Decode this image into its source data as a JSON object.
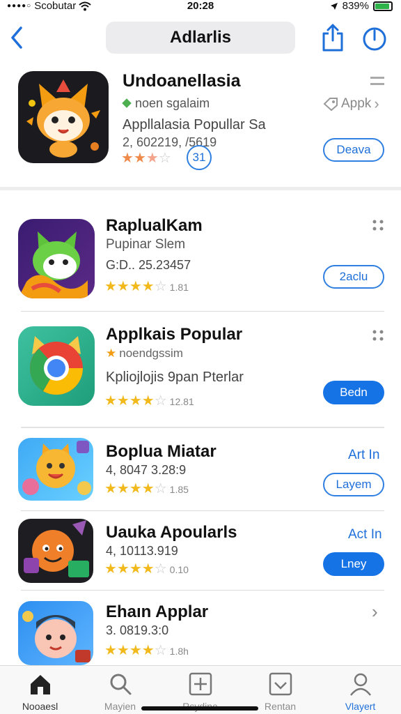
{
  "status_bar": {
    "carrier": "Scobutar",
    "time": "20:28",
    "battery_text": "839%"
  },
  "nav": {
    "title": "Adlarlis"
  },
  "featured": {
    "name": "Undoanellasia",
    "category": "noen sgalaim",
    "description": "Appllalasia Popullar Sa",
    "meta": "2, 602219, /5619",
    "rating": 3,
    "rating_count_badge": "31",
    "side_link": "Appk",
    "button_label": "Deava",
    "accent": "#1e6fd9"
  },
  "apps": [
    {
      "name": "RaplualKam",
      "subtitle": "Pupinar Slem",
      "meta": "G:D.. 25.23457",
      "rating": 4,
      "count": "1.81",
      "button_label": "2aclu",
      "button_style": "outline",
      "show_more": true
    },
    {
      "name": "Applkais Popular",
      "subtitle": "noendgssim",
      "meta": "Kpliojlojis 9pan Pterlar",
      "rating": 4,
      "count": "12.81",
      "button_label": "Bedn",
      "button_style": "fill",
      "show_more": true
    },
    {
      "name": "Boplua Miatar",
      "subtitle": "",
      "meta": "4, 8047 3.28:9",
      "rating": 4,
      "count": "1.85",
      "link_label": "Art In",
      "button_label": "Layem",
      "button_style": "outline",
      "show_more": false
    },
    {
      "name": "Uauka Apoularls",
      "subtitle": "",
      "meta": "4, 10113.919",
      "rating": 4,
      "count": "0.10",
      "link_label": "Act In",
      "button_label": "Lney",
      "button_style": "fill",
      "show_more": false
    },
    {
      "name": "Ehaın Applar",
      "subtitle": "",
      "meta": "3. 0819.3:0",
      "rating": 4,
      "count": "1.8h",
      "show_more": false
    }
  ],
  "tabs": [
    {
      "label": "Nooaesl",
      "icon": "home-icon",
      "active": false
    },
    {
      "label": "Mayien",
      "icon": "search-icon",
      "active": false
    },
    {
      "label": "Rsydine",
      "icon": "plus-square-icon",
      "active": false
    },
    {
      "label": "Rentan",
      "icon": "inbox-icon",
      "active": false
    },
    {
      "label": "Vlayert",
      "icon": "profile-icon",
      "active": true
    }
  ],
  "colors": {
    "accent_blue": "#1673e6",
    "star_yellow": "#f2b91c",
    "star_orange": "#ef8a4a"
  }
}
